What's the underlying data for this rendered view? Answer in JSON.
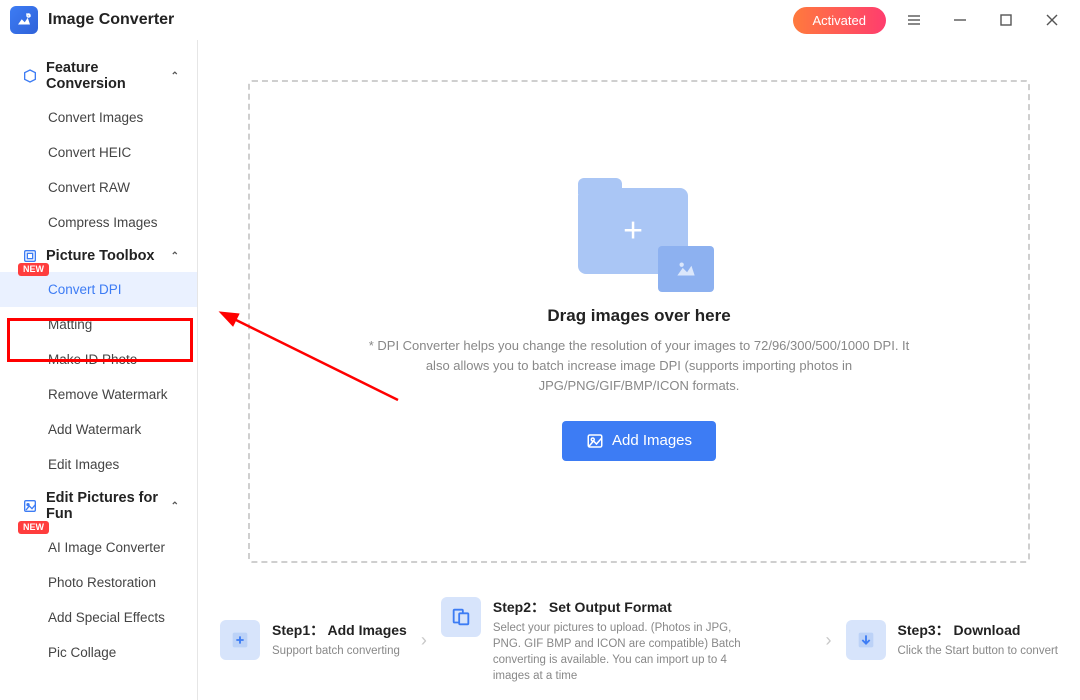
{
  "app": {
    "title": "Image Converter"
  },
  "titlebar": {
    "activated": "Activated"
  },
  "sidebar": {
    "sections": [
      {
        "title": "Feature Conversion",
        "items": [
          "Convert Images",
          "Convert HEIC",
          "Convert RAW",
          "Compress Images"
        ]
      },
      {
        "title": "Picture Toolbox",
        "items": [
          "Convert DPI",
          "Matting",
          "Make ID Photo",
          "Remove Watermark",
          "Add Watermark",
          "Edit Images"
        ],
        "new_badge": "NEW"
      },
      {
        "title": "Edit Pictures for Fun",
        "items": [
          "AI Image Converter",
          "Photo Restoration",
          "Add Special Effects",
          "Pic Collage"
        ],
        "new_badge": "NEW"
      }
    ]
  },
  "main": {
    "drop_title": "Drag images over here",
    "drop_desc": "* DPI Converter helps you change the resolution of your images to 72/96/300/500/1000 DPI. It also allows you to batch increase image DPI (supports importing photos in JPG/PNG/GIF/BMP/ICON formats.",
    "add_button": "Add Images"
  },
  "steps": {
    "s1": {
      "title": "Step1： Add Images",
      "desc": "Support batch converting"
    },
    "s2": {
      "title": "Step2： Set Output Format",
      "desc": "Select your pictures to upload. (Photos in JPG, PNG. GIF BMP and ICON are compatible) Batch converting is available. You can import up to 4 images at a time"
    },
    "s3": {
      "title": "Step3： Download",
      "desc": "Click the Start button to convert"
    }
  }
}
